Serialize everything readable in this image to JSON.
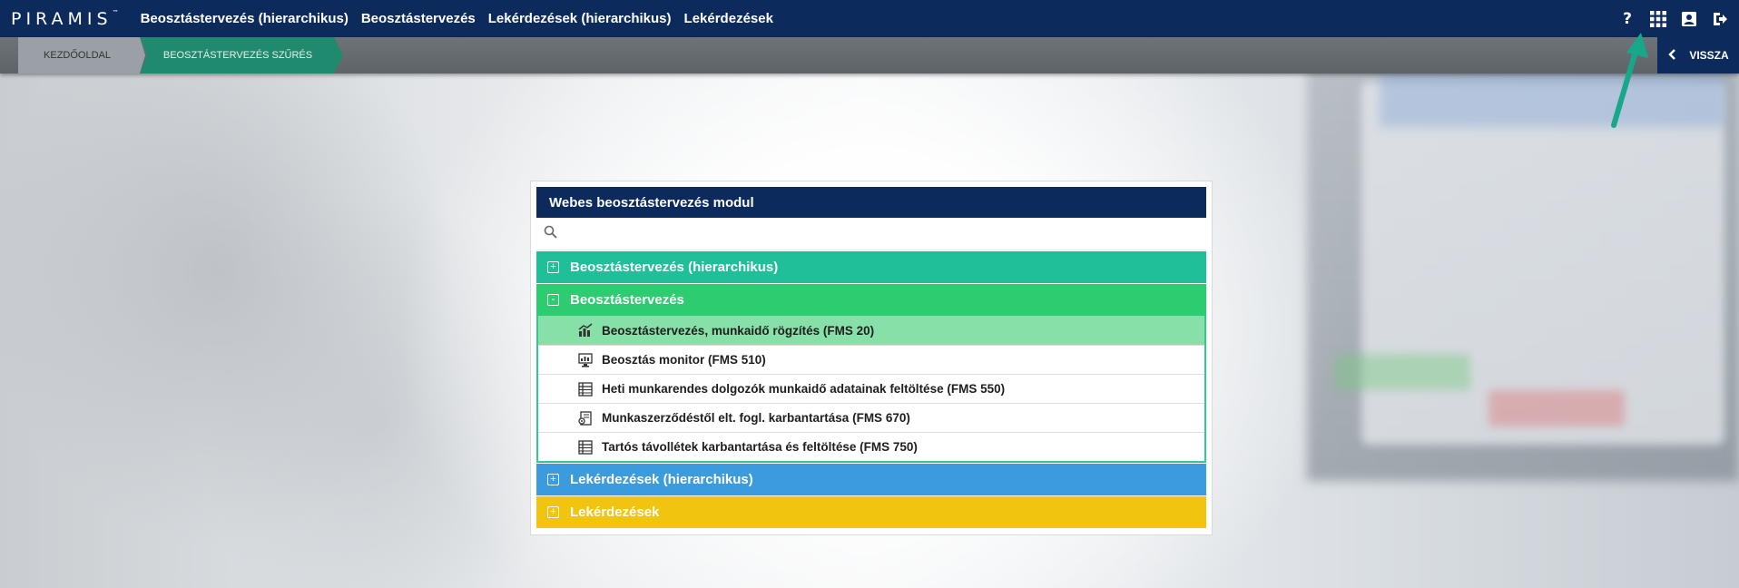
{
  "app": {
    "logo": "PIRAMIS",
    "logo_tm": "™"
  },
  "nav": {
    "items": [
      "Beosztástervezés (hierarchikus)",
      "Beosztástervezés",
      "Lekérdezések (hierarchikus)",
      "Lekérdezések"
    ]
  },
  "top_icons": {
    "help": "?",
    "help_icon": "help-icon",
    "apps_icon": "apps-grid-icon",
    "profile_icon": "contact-card-icon",
    "logout_icon": "logout-icon"
  },
  "breadcrumb": {
    "home": "KEZDŐOLDAL",
    "current": "BEOSZTÁSTERVEZÉS SZŰRÉS",
    "back": "VISSZA"
  },
  "panel": {
    "title": "Webes beosztástervezés modul",
    "search_placeholder": "",
    "groups": [
      {
        "label": "Beosztástervezés (hierarchikus)",
        "toggle": "+",
        "color": "#1fbf9a"
      },
      {
        "label": "Beosztástervezés",
        "toggle": "-",
        "color": "#2ecc71"
      },
      {
        "label": "Lekérdezések (hierarchikus)",
        "toggle": "+",
        "color": "#3b9bdc"
      },
      {
        "label": "Lekérdezések",
        "toggle": "+",
        "color": "#f1c40f"
      }
    ],
    "items": [
      {
        "label": "Beosztástervezés, munkaidő rögzítés (FMS 20)",
        "icon": "chart-edit-icon",
        "selected": true
      },
      {
        "label": "Beosztás monitor (FMS 510)",
        "icon": "monitor-chart-icon",
        "selected": false
      },
      {
        "label": "Heti munkarendes dolgozók munkaidő adatainak feltöltése (FMS 550)",
        "icon": "table-icon",
        "selected": false
      },
      {
        "label": "Munkaszerződéstől elt. fogl. karbantartása (FMS 670)",
        "icon": "contract-icon",
        "selected": false
      },
      {
        "label": "Tartós távollétek karbantartása és feltöltése (FMS 750)",
        "icon": "table-icon",
        "selected": false
      }
    ]
  },
  "colors": {
    "navy": "#0d2a5c",
    "breadcrumb_active": "#1f8a6d",
    "selected_item": "#86e0a8",
    "annotation_arrow": "#17a88a"
  }
}
